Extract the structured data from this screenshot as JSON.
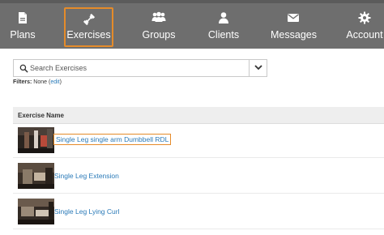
{
  "nav": {
    "items": [
      {
        "label": "Plans",
        "icon": "document-icon"
      },
      {
        "label": "Exercises",
        "icon": "dumbbell-icon",
        "active": true
      },
      {
        "label": "Groups",
        "icon": "group-icon"
      },
      {
        "label": "Clients",
        "icon": "user-icon"
      },
      {
        "label": "Messages",
        "icon": "envelope-icon"
      },
      {
        "label": "Account",
        "icon": "gear-icon"
      }
    ],
    "highlight_color": "#e58b2a",
    "background": "#6e6e6e"
  },
  "search": {
    "placeholder": "Search Exercises",
    "value": ""
  },
  "filters": {
    "label": "Filters:",
    "value": "None",
    "edit_label": "edit"
  },
  "table": {
    "header": "Exercise Name",
    "rows": [
      {
        "name": "Single Leg single arm Dumbbell RDL",
        "highlighted": true
      },
      {
        "name": "Single Leg Extension",
        "highlighted": false
      },
      {
        "name": "Single Leg Lying Curl",
        "highlighted": false
      }
    ]
  },
  "link_color": "#2a7ab8"
}
